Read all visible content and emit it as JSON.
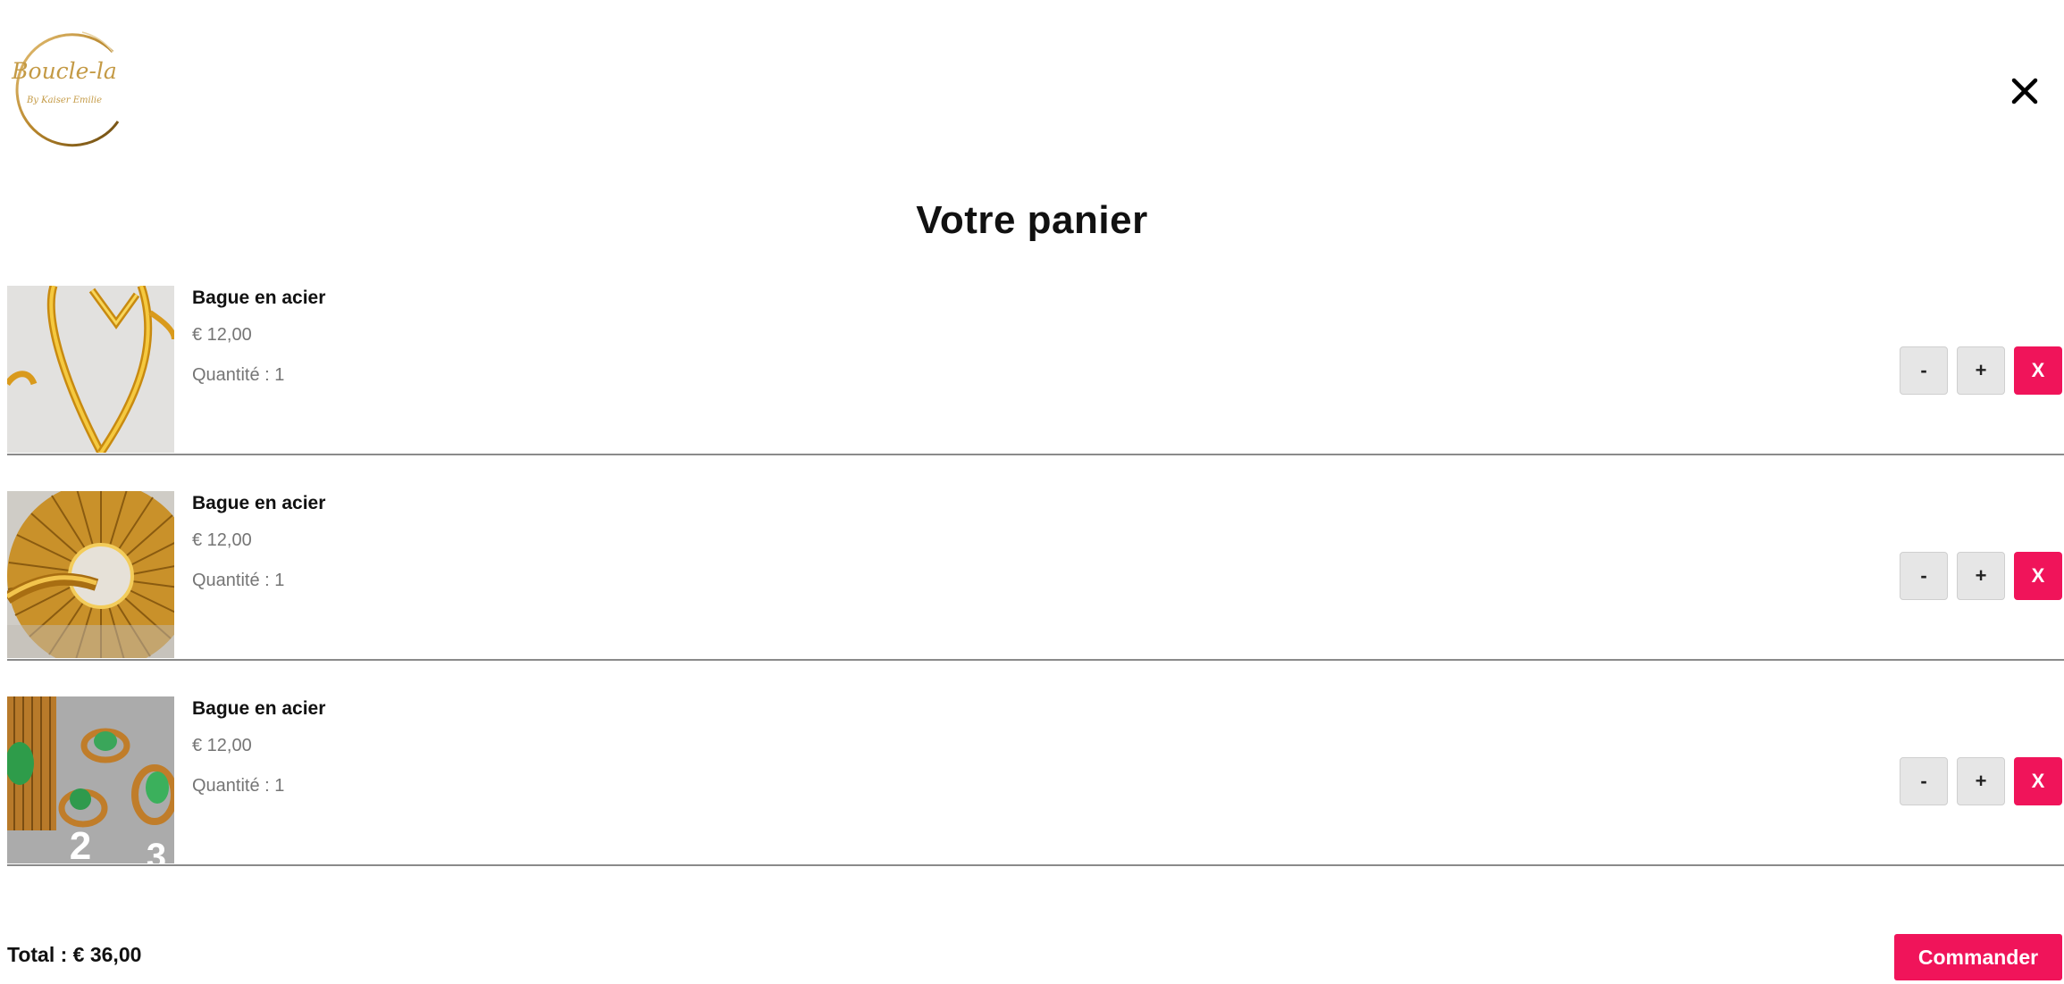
{
  "brand": {
    "logo_text": "Boucle-la",
    "logo_subtext": "By Kaiser Emilie",
    "accent_color": "#f0145a"
  },
  "header": {
    "close_icon": "close-icon"
  },
  "cart": {
    "title": "Votre panier",
    "items": [
      {
        "name": "Bague en acier",
        "price": "€ 12,00",
        "quantity": "Quantité : 1",
        "image": "gold-heart-ring"
      },
      {
        "name": "Bague en acier",
        "price": "€ 12,00",
        "quantity": "Quantité : 1",
        "image": "gold-sun-ring"
      },
      {
        "name": "Bague en acier",
        "price": "€ 12,00",
        "quantity": "Quantité : 1",
        "image": "green-stone-rings"
      }
    ],
    "buttons": {
      "decrease": "-",
      "increase": "+",
      "remove": "X"
    },
    "total": "Total : € 36,00",
    "order_label": "Commander"
  }
}
